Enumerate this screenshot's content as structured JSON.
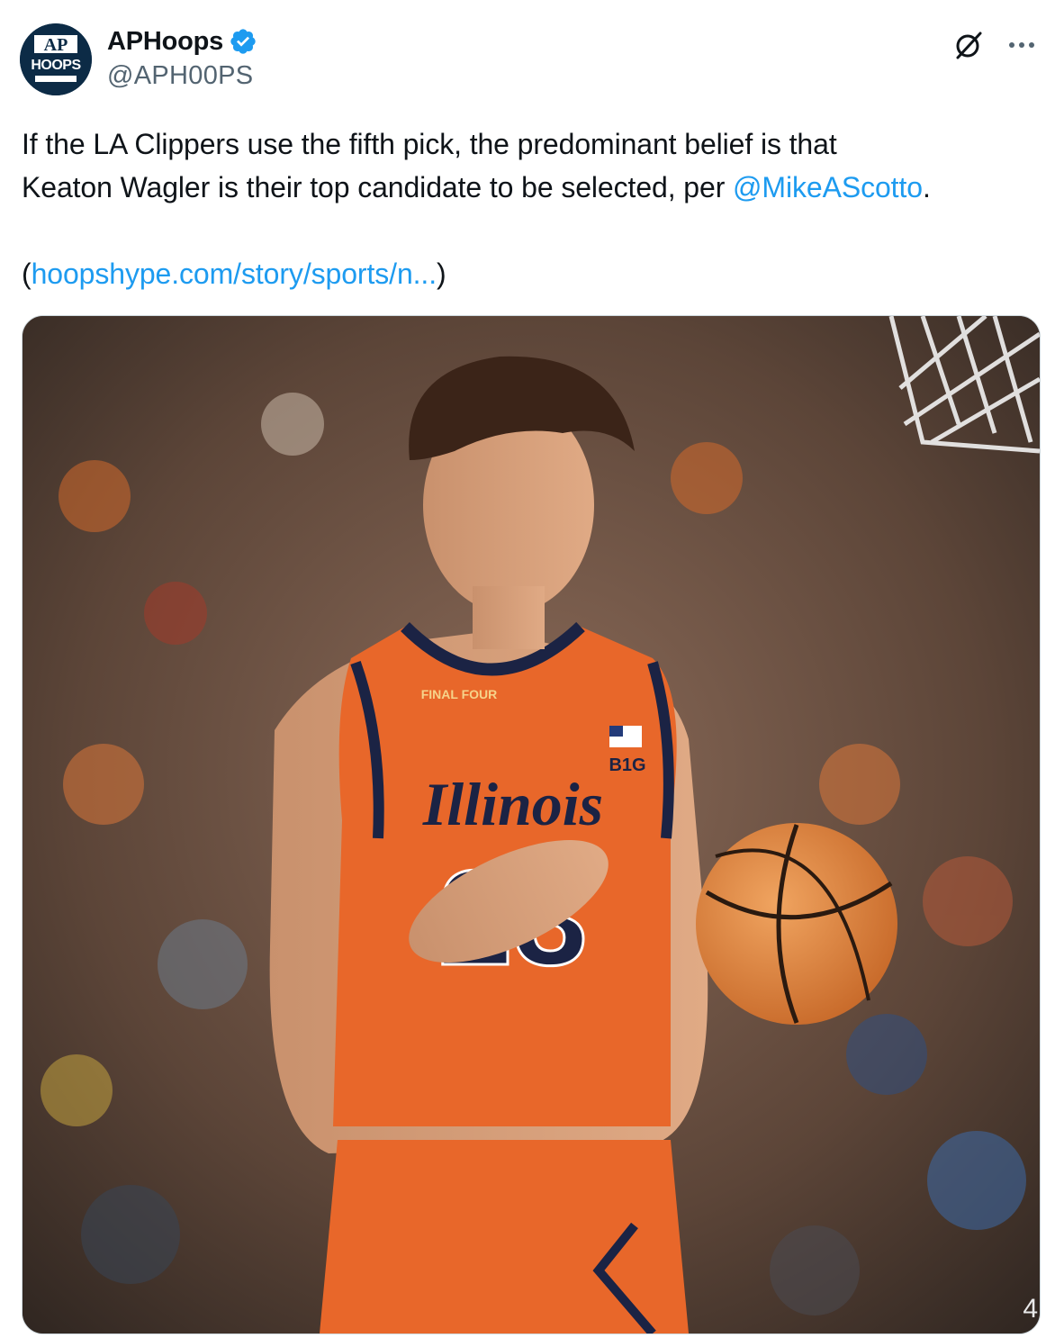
{
  "tweet": {
    "author": {
      "display_name": "APHoops",
      "handle": "@APH00PS",
      "verified": true,
      "avatar_icon": "ap-hoops-logo",
      "avatar_text": "AP HOOPS"
    },
    "text_line1": "If the LA Clippers use the fifth pick, the predominant belief is that",
    "text_line2_prefix": "Keaton Wagler is their top candidate to be selected, per ",
    "mention": "@MikeAScotto",
    "text_line2_suffix": ".",
    "link_open": "(",
    "link": "hoopshype.com/story/sports/n...",
    "link_close": ")",
    "media": {
      "icon": "basketball-player-photo",
      "jersey_text": "Illinois",
      "jersey_number": "23",
      "patch_text": "FINAL FOUR",
      "conference_text": "B1G"
    }
  },
  "icons": {
    "grok": "grok-icon",
    "more": "more-icon",
    "verified": "verified-badge-icon"
  },
  "colors": {
    "link": "#1d9bf0",
    "verified": "#1d9bf0",
    "secondary_text": "#536471",
    "jersey_orange": "#e8672a",
    "jersey_navy": "#1b2344"
  }
}
